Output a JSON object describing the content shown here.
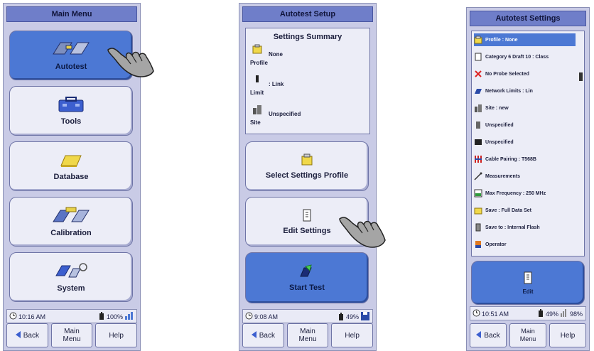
{
  "left_panel": {
    "title": "Main Menu",
    "buttons": [
      {
        "label": "Autotest",
        "icon": "autotest-icon"
      },
      {
        "label": "Tools",
        "icon": "toolbox-icon"
      },
      {
        "label": "Database",
        "icon": "database-icon"
      },
      {
        "label": "Calibration",
        "icon": "calibration-icon"
      },
      {
        "label": "System",
        "icon": "system-icon"
      }
    ],
    "status": {
      "time": "10:16 AM",
      "battery": "100%"
    },
    "bottom": {
      "back": "Back",
      "main_menu": "Main Menu",
      "help": "Help"
    }
  },
  "middle_panel": {
    "title": "Autotest Setup",
    "summary": {
      "title": "Settings Summary",
      "rows": [
        {
          "label": "Profile",
          "value": "None"
        },
        {
          "label": "Limit",
          "value": ": Link"
        },
        {
          "label": "Site",
          "value": "Unspecified"
        }
      ]
    },
    "buttons": {
      "select_profile": "Select Settings Profile",
      "edit_settings": "Edit Settings",
      "start_test": "Start Test"
    },
    "status": {
      "time": "9:08 AM",
      "battery": "49%"
    },
    "bottom": {
      "back": "Back",
      "main_menu": "Main Menu",
      "help": "Help"
    }
  },
  "right_panel": {
    "title": "Autotest Settings",
    "items": [
      {
        "label": "Profile : None",
        "icon": "profile-icon"
      },
      {
        "label": "Category 6 Draft 10 : Class",
        "icon": "document-icon"
      },
      {
        "label": "No Probe Selected",
        "icon": "x-mark-icon"
      },
      {
        "label": "Network Limits : Lin",
        "icon": "network-icon"
      },
      {
        "label": "Site : new",
        "icon": "site-icon"
      },
      {
        "label": "Unspecified",
        "icon": "remote-icon"
      },
      {
        "label": "Unspecified",
        "icon": "connector-icon"
      },
      {
        "label": "Cable Pairing : T568B",
        "icon": "pairing-icon"
      },
      {
        "label": "Measurements",
        "icon": "probe-icon"
      },
      {
        "label": "Max Frequency : 250 MHz",
        "icon": "frequency-icon"
      },
      {
        "label": "Save : Full Data Set",
        "icon": "save-folder-icon"
      },
      {
        "label": "Save to : Internal Flash",
        "icon": "flash-icon"
      },
      {
        "label": "Operator",
        "icon": "operator-icon"
      }
    ],
    "edit_label": "Edit",
    "status": {
      "time": "10:51 AM",
      "battery": "49%",
      "signal": "98%"
    },
    "bottom": {
      "back": "Back",
      "main_menu": "Main Menu",
      "help": "Help"
    }
  },
  "colors": {
    "panel": "#c9cbe6",
    "title_bar": "#6f7ec9",
    "selected": "#4c78d4",
    "button": "#ecedf7"
  }
}
